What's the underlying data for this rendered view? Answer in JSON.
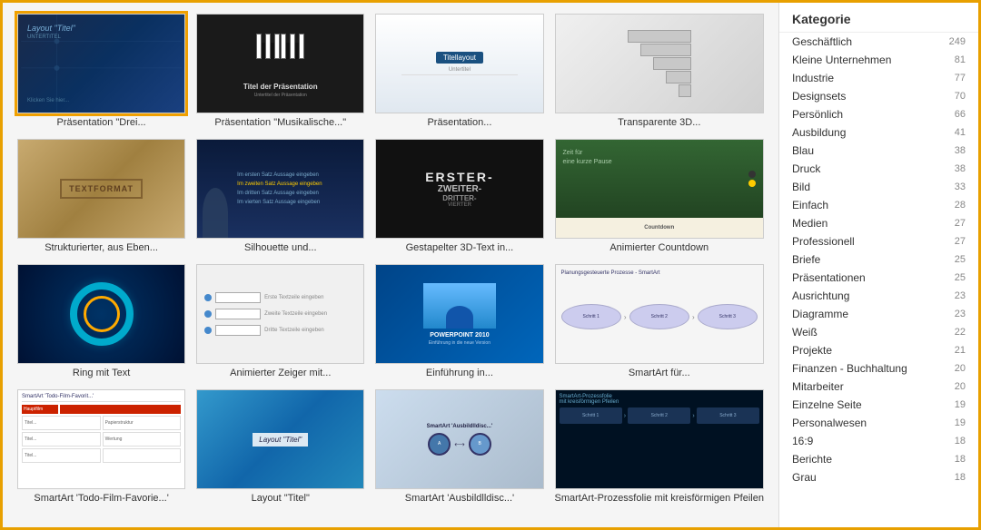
{
  "sidebar": {
    "header": "Kategorie",
    "items": [
      {
        "label": "Geschäftlich",
        "count": "249"
      },
      {
        "label": "Kleine Unternehmen",
        "count": "81"
      },
      {
        "label": "Industrie",
        "count": "77"
      },
      {
        "label": "Designsets",
        "count": "70"
      },
      {
        "label": "Persönlich",
        "count": "66"
      },
      {
        "label": "Ausbildung",
        "count": "41"
      },
      {
        "label": "Blau",
        "count": "38"
      },
      {
        "label": "Druck",
        "count": "38"
      },
      {
        "label": "Bild",
        "count": "33"
      },
      {
        "label": "Einfach",
        "count": "28"
      },
      {
        "label": "Medien",
        "count": "27"
      },
      {
        "label": "Professionell",
        "count": "27"
      },
      {
        "label": "Briefe",
        "count": "25"
      },
      {
        "label": "Präsentationen",
        "count": "25"
      },
      {
        "label": "Ausrichtung",
        "count": "23"
      },
      {
        "label": "Diagramme",
        "count": "23"
      },
      {
        "label": "Weiß",
        "count": "22"
      },
      {
        "label": "Projekte",
        "count": "21"
      },
      {
        "label": "Finanzen - Buchhaltung",
        "count": "20"
      },
      {
        "label": "Mitarbeiter",
        "count": "20"
      },
      {
        "label": "Einzelne Seite",
        "count": "19"
      },
      {
        "label": "Personalwesen",
        "count": "19"
      },
      {
        "label": "16:9",
        "count": "18"
      },
      {
        "label": "Berichte",
        "count": "18"
      },
      {
        "label": "Grau",
        "count": "18"
      }
    ]
  },
  "gallery": {
    "items": [
      {
        "id": "drei",
        "label": "Präsentation \"Drei...",
        "selected": true
      },
      {
        "id": "musik",
        "label": "Präsentation \"Musikalische...\""
      },
      {
        "id": "praesentation",
        "label": "Präsentation..."
      },
      {
        "id": "transparente3d",
        "label": "Transparente 3D..."
      },
      {
        "id": "textformat",
        "label": "Strukturierter, aus Eben..."
      },
      {
        "id": "silhouette",
        "label": "Silhouette und..."
      },
      {
        "id": "gestapelt",
        "label": "Gestapelter 3D-Text in..."
      },
      {
        "id": "countdown",
        "label": "Animierter Countdown"
      },
      {
        "id": "ring",
        "label": "Ring mit Text"
      },
      {
        "id": "zeiger",
        "label": "Animierter Zeiger mit..."
      },
      {
        "id": "einfuhrung",
        "label": "Einführung in..."
      },
      {
        "id": "smartart",
        "label": "SmartArt für..."
      },
      {
        "id": "smartart2",
        "label": "SmartArt 'Todo-Film-Favorie...'"
      },
      {
        "id": "layout",
        "label": "Layout \"Titel\""
      },
      {
        "id": "smartart3",
        "label": "SmartArt 'Ausbildlldisc...'"
      },
      {
        "id": "prozess",
        "label": "SmartArt-Prozessfolie mit kreisförmigen Pfeilen"
      }
    ]
  }
}
